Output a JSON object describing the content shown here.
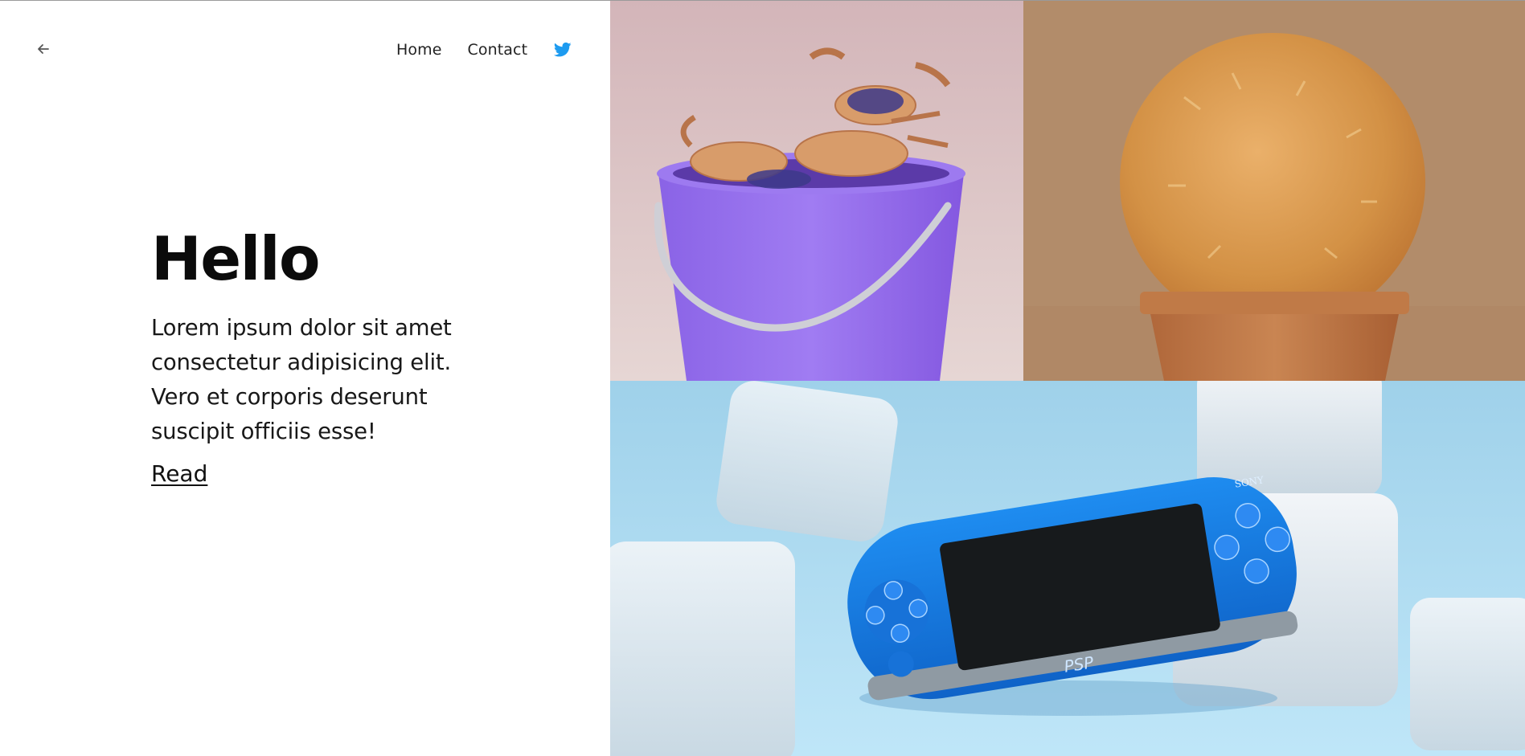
{
  "nav": {
    "back_icon": "arrow-left-icon",
    "links": [
      {
        "label": "Home"
      },
      {
        "label": "Contact"
      }
    ],
    "social_icon": "twitter-icon",
    "social_color": "#1d9bf0"
  },
  "hero": {
    "title": "Hello",
    "body": "Lorem ipsum dolor sit amet consectetur adipisicing elit. Vero et corporis deserunt suscipit officiis esse!",
    "read_label": "Read"
  },
  "gallery": {
    "images": [
      {
        "subject": "crabs in a purple bucket",
        "bg": "#d9c0c4"
      },
      {
        "subject": "fuzzy cactus in clay pot",
        "bg": "#b38c6a"
      },
      {
        "subject": "blue handheld console with white cubes",
        "bg": "#a9d6ee"
      }
    ],
    "psp_brand": "SONY",
    "psp_logo": "PSP"
  }
}
